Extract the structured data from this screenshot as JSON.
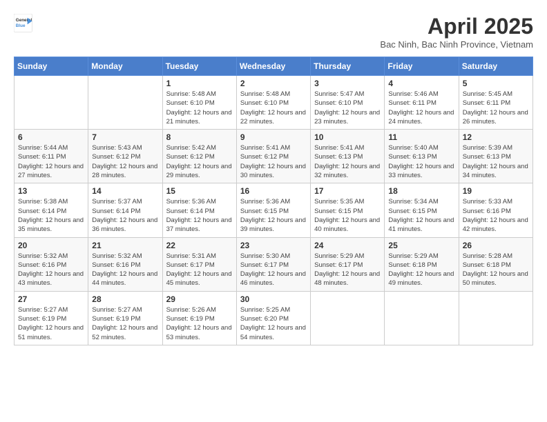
{
  "logo": {
    "general": "General",
    "blue": "Blue"
  },
  "header": {
    "title": "April 2025",
    "subtitle": "Bac Ninh, Bac Ninh Province, Vietnam"
  },
  "weekdays": [
    "Sunday",
    "Monday",
    "Tuesday",
    "Wednesday",
    "Thursday",
    "Friday",
    "Saturday"
  ],
  "weeks": [
    [
      {
        "day": "",
        "info": ""
      },
      {
        "day": "",
        "info": ""
      },
      {
        "day": "1",
        "info": "Sunrise: 5:48 AM\nSunset: 6:10 PM\nDaylight: 12 hours and 21 minutes."
      },
      {
        "day": "2",
        "info": "Sunrise: 5:48 AM\nSunset: 6:10 PM\nDaylight: 12 hours and 22 minutes."
      },
      {
        "day": "3",
        "info": "Sunrise: 5:47 AM\nSunset: 6:10 PM\nDaylight: 12 hours and 23 minutes."
      },
      {
        "day": "4",
        "info": "Sunrise: 5:46 AM\nSunset: 6:11 PM\nDaylight: 12 hours and 24 minutes."
      },
      {
        "day": "5",
        "info": "Sunrise: 5:45 AM\nSunset: 6:11 PM\nDaylight: 12 hours and 26 minutes."
      }
    ],
    [
      {
        "day": "6",
        "info": "Sunrise: 5:44 AM\nSunset: 6:11 PM\nDaylight: 12 hours and 27 minutes."
      },
      {
        "day": "7",
        "info": "Sunrise: 5:43 AM\nSunset: 6:12 PM\nDaylight: 12 hours and 28 minutes."
      },
      {
        "day": "8",
        "info": "Sunrise: 5:42 AM\nSunset: 6:12 PM\nDaylight: 12 hours and 29 minutes."
      },
      {
        "day": "9",
        "info": "Sunrise: 5:41 AM\nSunset: 6:12 PM\nDaylight: 12 hours and 30 minutes."
      },
      {
        "day": "10",
        "info": "Sunrise: 5:41 AM\nSunset: 6:13 PM\nDaylight: 12 hours and 32 minutes."
      },
      {
        "day": "11",
        "info": "Sunrise: 5:40 AM\nSunset: 6:13 PM\nDaylight: 12 hours and 33 minutes."
      },
      {
        "day": "12",
        "info": "Sunrise: 5:39 AM\nSunset: 6:13 PM\nDaylight: 12 hours and 34 minutes."
      }
    ],
    [
      {
        "day": "13",
        "info": "Sunrise: 5:38 AM\nSunset: 6:14 PM\nDaylight: 12 hours and 35 minutes."
      },
      {
        "day": "14",
        "info": "Sunrise: 5:37 AM\nSunset: 6:14 PM\nDaylight: 12 hours and 36 minutes."
      },
      {
        "day": "15",
        "info": "Sunrise: 5:36 AM\nSunset: 6:14 PM\nDaylight: 12 hours and 37 minutes."
      },
      {
        "day": "16",
        "info": "Sunrise: 5:36 AM\nSunset: 6:15 PM\nDaylight: 12 hours and 39 minutes."
      },
      {
        "day": "17",
        "info": "Sunrise: 5:35 AM\nSunset: 6:15 PM\nDaylight: 12 hours and 40 minutes."
      },
      {
        "day": "18",
        "info": "Sunrise: 5:34 AM\nSunset: 6:15 PM\nDaylight: 12 hours and 41 minutes."
      },
      {
        "day": "19",
        "info": "Sunrise: 5:33 AM\nSunset: 6:16 PM\nDaylight: 12 hours and 42 minutes."
      }
    ],
    [
      {
        "day": "20",
        "info": "Sunrise: 5:32 AM\nSunset: 6:16 PM\nDaylight: 12 hours and 43 minutes."
      },
      {
        "day": "21",
        "info": "Sunrise: 5:32 AM\nSunset: 6:16 PM\nDaylight: 12 hours and 44 minutes."
      },
      {
        "day": "22",
        "info": "Sunrise: 5:31 AM\nSunset: 6:17 PM\nDaylight: 12 hours and 45 minutes."
      },
      {
        "day": "23",
        "info": "Sunrise: 5:30 AM\nSunset: 6:17 PM\nDaylight: 12 hours and 46 minutes."
      },
      {
        "day": "24",
        "info": "Sunrise: 5:29 AM\nSunset: 6:17 PM\nDaylight: 12 hours and 48 minutes."
      },
      {
        "day": "25",
        "info": "Sunrise: 5:29 AM\nSunset: 6:18 PM\nDaylight: 12 hours and 49 minutes."
      },
      {
        "day": "26",
        "info": "Sunrise: 5:28 AM\nSunset: 6:18 PM\nDaylight: 12 hours and 50 minutes."
      }
    ],
    [
      {
        "day": "27",
        "info": "Sunrise: 5:27 AM\nSunset: 6:19 PM\nDaylight: 12 hours and 51 minutes."
      },
      {
        "day": "28",
        "info": "Sunrise: 5:27 AM\nSunset: 6:19 PM\nDaylight: 12 hours and 52 minutes."
      },
      {
        "day": "29",
        "info": "Sunrise: 5:26 AM\nSunset: 6:19 PM\nDaylight: 12 hours and 53 minutes."
      },
      {
        "day": "30",
        "info": "Sunrise: 5:25 AM\nSunset: 6:20 PM\nDaylight: 12 hours and 54 minutes."
      },
      {
        "day": "",
        "info": ""
      },
      {
        "day": "",
        "info": ""
      },
      {
        "day": "",
        "info": ""
      }
    ]
  ]
}
